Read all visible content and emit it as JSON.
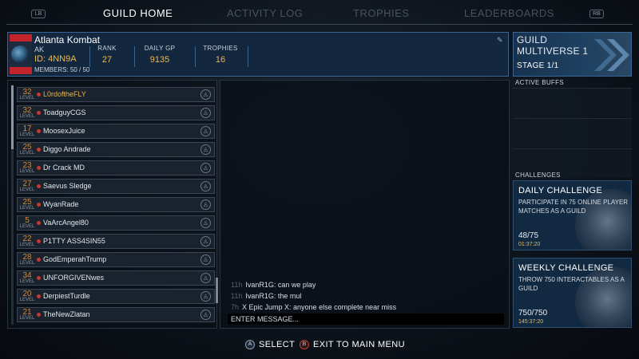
{
  "nav": {
    "lb": "LB",
    "rb": "RB",
    "tabs": [
      {
        "label": "GUILD HOME",
        "active": true
      },
      {
        "label": "ACTIVITY LOG",
        "active": false
      },
      {
        "label": "TROPHIES",
        "active": false
      },
      {
        "label": "LEADERBOARDS",
        "active": false
      }
    ]
  },
  "guild": {
    "name": "Atlanta Kombat",
    "tag": "AK",
    "id": "ID: 4NN9A",
    "members": "MEMBERS: 50 / 50",
    "stats": [
      {
        "label": "RANK",
        "value": "27"
      },
      {
        "label": "DAILY GP",
        "value": "9135"
      },
      {
        "label": "TROPHIES",
        "value": "16"
      }
    ]
  },
  "members": {
    "level_label": "LEVEL",
    "items": [
      {
        "level": "32",
        "name": "L0rdoftheFLY",
        "highlight": true
      },
      {
        "level": "32",
        "name": "ToadguyCGS",
        "highlight": false
      },
      {
        "level": "17",
        "name": "MoosexJuice",
        "highlight": false
      },
      {
        "level": "25",
        "name": "Diggo Andrade",
        "highlight": false
      },
      {
        "level": "23",
        "name": "Dr Crack MD",
        "highlight": false
      },
      {
        "level": "27",
        "name": "Saevus Sledge",
        "highlight": false
      },
      {
        "level": "25",
        "name": "WyanRade",
        "highlight": false
      },
      {
        "level": "5",
        "name": "VaArcAngel80",
        "highlight": false
      },
      {
        "level": "22",
        "name": "P1TTY ASS4SIN55",
        "highlight": false
      },
      {
        "level": "28",
        "name": "GodEmperahTrump",
        "highlight": false
      },
      {
        "level": "34",
        "name": "UNFORGIVENwes",
        "highlight": false
      },
      {
        "level": "20",
        "name": "DerpiestTurdle",
        "highlight": false
      },
      {
        "level": "21",
        "name": "TheNewZlatan",
        "highlight": false
      }
    ]
  },
  "chat": {
    "messages": [
      {
        "time": "11h",
        "text": "IvanR1G: can we play"
      },
      {
        "time": "11h",
        "text": "IvanR1G: the mul"
      },
      {
        "time": "7h",
        "text": "X Epic Jump X: anyone else complete near miss"
      }
    ],
    "input_placeholder": "ENTER MESSAGE..."
  },
  "multiverse": {
    "title_line1": "GUILD",
    "title_line2": "MULTIVERSE 1",
    "stage": "STAGE 1/1"
  },
  "buffs": {
    "label": "ACTIVE BUFFS"
  },
  "challenges": {
    "label": "CHALLENGES",
    "daily": {
      "title": "DAILY CHALLENGE",
      "description": "PARTICIPATE IN 75 ONLINE PLAYER MATCHES AS A GUILD",
      "progress": "48/75",
      "time_left": "01:37:20"
    },
    "weekly": {
      "title": "WEEKLY CHALLENGE",
      "description": "THROW 750 INTERACTABLES AS A GUILD",
      "progress": "750/750",
      "time_left": "145:37:20"
    }
  },
  "prompts": {
    "a_button": "A",
    "a_label": "SELECT",
    "b_button": "B",
    "b_label": "EXIT TO MAIN MENU"
  },
  "colors": {
    "accent_gold": "#f0b84a",
    "panel_blue": "#13273f",
    "online_dot": "#c23a33"
  }
}
